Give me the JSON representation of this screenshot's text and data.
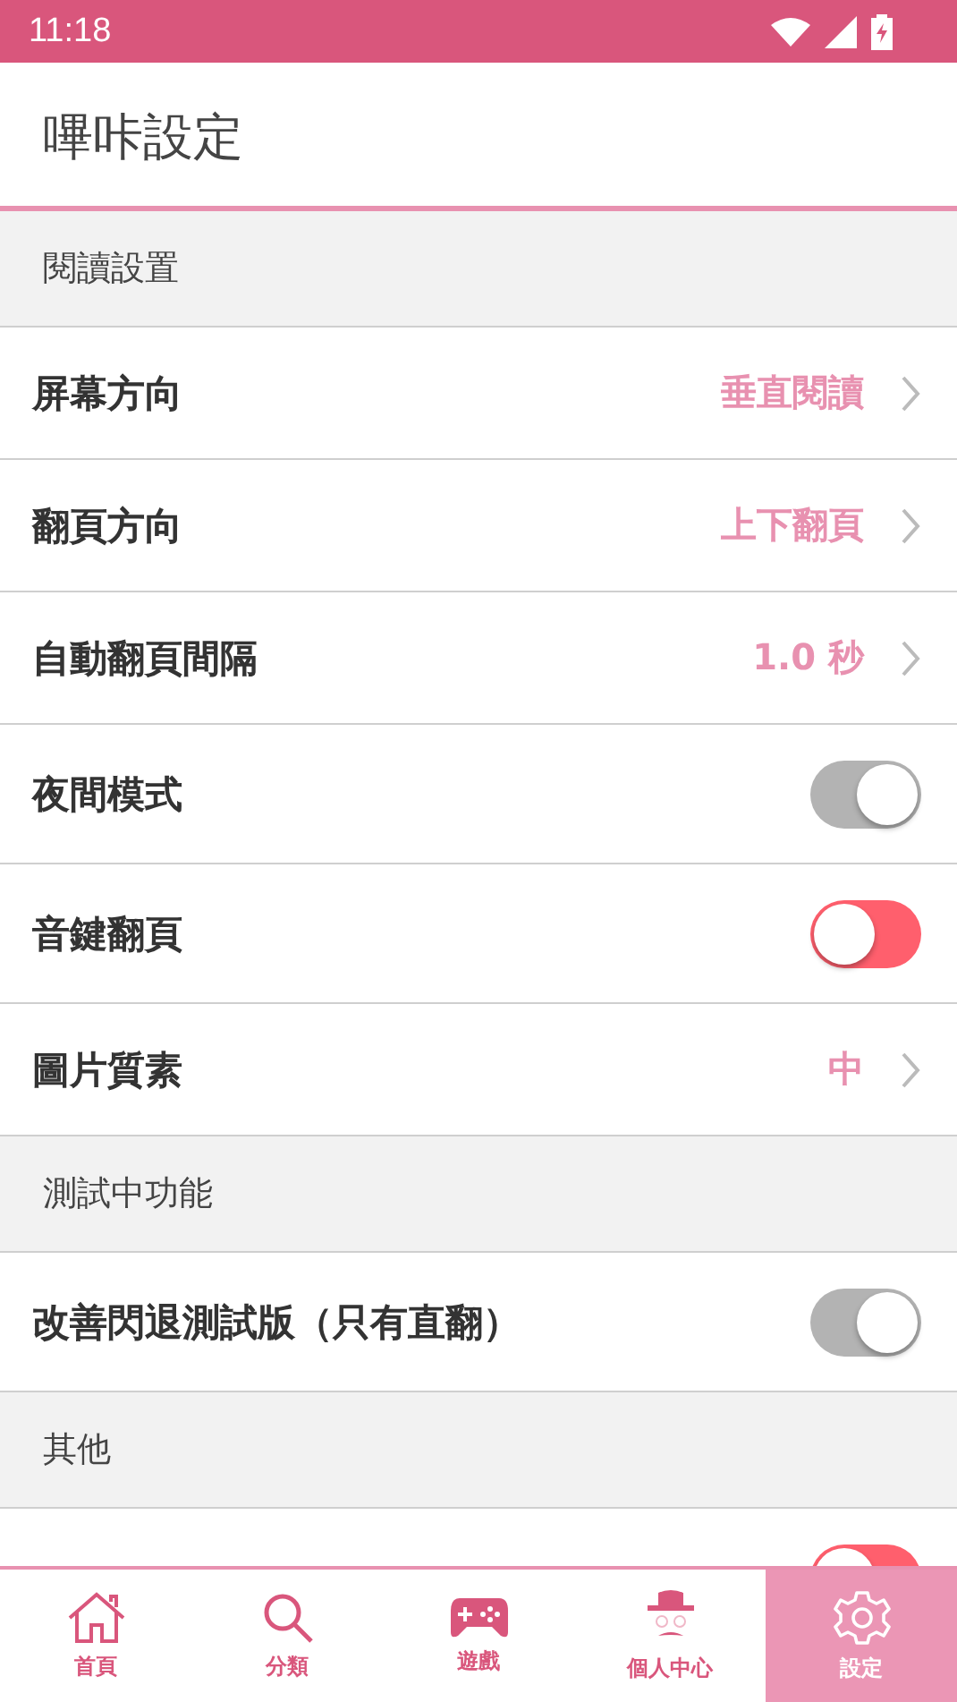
{
  "status_bar": {
    "time": "11:18"
  },
  "header": {
    "title": "嗶咔設定"
  },
  "sections": [
    {
      "title": "閱讀設置",
      "rows": [
        {
          "kind": "value",
          "label": "屏幕方向",
          "value": "垂直閱讀"
        },
        {
          "kind": "value",
          "label": "翻頁方向",
          "value": "上下翻頁"
        },
        {
          "kind": "value",
          "label": "自動翻頁間隔",
          "value": "1.0 秒"
        },
        {
          "kind": "switch",
          "label": "夜間模式",
          "on": true
        },
        {
          "kind": "switch",
          "label": "音鍵翻頁",
          "on": false
        },
        {
          "kind": "value",
          "label": "圖片質素",
          "value": "中"
        }
      ]
    },
    {
      "title": "測試中功能",
      "rows": [
        {
          "kind": "switch",
          "label": "改善閃退測試版（只有直翻）",
          "on": true
        }
      ]
    },
    {
      "title": "其他",
      "rows": [
        {
          "kind": "switch",
          "on": false
        }
      ]
    }
  ],
  "nav": [
    {
      "label": "首頁",
      "selected": false
    },
    {
      "label": "分類",
      "selected": false
    },
    {
      "label": "遊戲",
      "selected": false
    },
    {
      "label": "個人中心",
      "selected": false
    },
    {
      "label": "設定",
      "selected": true
    }
  ]
}
